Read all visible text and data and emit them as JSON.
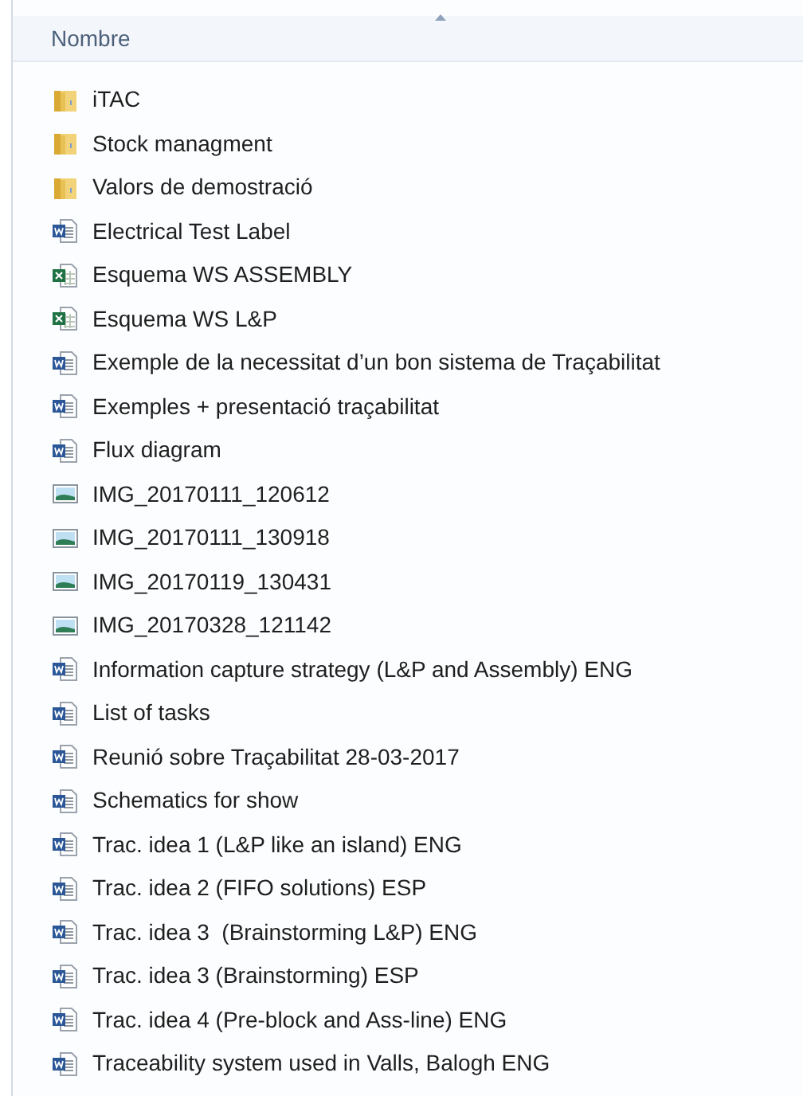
{
  "header": {
    "column": "Nombre",
    "sorted_ascending": true
  },
  "files": [
    {
      "name": "iTAC",
      "kind": "folder"
    },
    {
      "name": "Stock managment",
      "kind": "folder"
    },
    {
      "name": "Valors de demostració",
      "kind": "folder"
    },
    {
      "name": "Electrical Test Label",
      "kind": "word"
    },
    {
      "name": "Esquema WS ASSEMBLY",
      "kind": "excel"
    },
    {
      "name": "Esquema WS L&P",
      "kind": "excel"
    },
    {
      "name": "Exemple de la necessitat d’un bon sistema de Traçabilitat",
      "kind": "word"
    },
    {
      "name": "Exemples + presentació traçabilitat",
      "kind": "word"
    },
    {
      "name": "Flux diagram",
      "kind": "word"
    },
    {
      "name": "IMG_20170111_120612",
      "kind": "image"
    },
    {
      "name": "IMG_20170111_130918",
      "kind": "image"
    },
    {
      "name": "IMG_20170119_130431",
      "kind": "image"
    },
    {
      "name": "IMG_20170328_121142",
      "kind": "image"
    },
    {
      "name": "Information capture strategy (L&P and Assembly) ENG",
      "kind": "word"
    },
    {
      "name": "List of tasks",
      "kind": "word"
    },
    {
      "name": "Reunió sobre Traçabilitat 28-03-2017",
      "kind": "word"
    },
    {
      "name": "Schematics for show",
      "kind": "word"
    },
    {
      "name": "Trac. idea 1 (L&P like an island) ENG",
      "kind": "word"
    },
    {
      "name": "Trac. idea 2 (FIFO solutions) ESP",
      "kind": "word"
    },
    {
      "name": "Trac. idea 3  (Brainstorming L&P) ENG",
      "kind": "word"
    },
    {
      "name": "Trac. idea 3 (Brainstorming) ESP",
      "kind": "word"
    },
    {
      "name": "Trac. idea 4 (Pre-block and Ass-line) ENG",
      "kind": "word"
    },
    {
      "name": "Traceability system used in Valls, Balogh ENG",
      "kind": "word"
    }
  ]
}
